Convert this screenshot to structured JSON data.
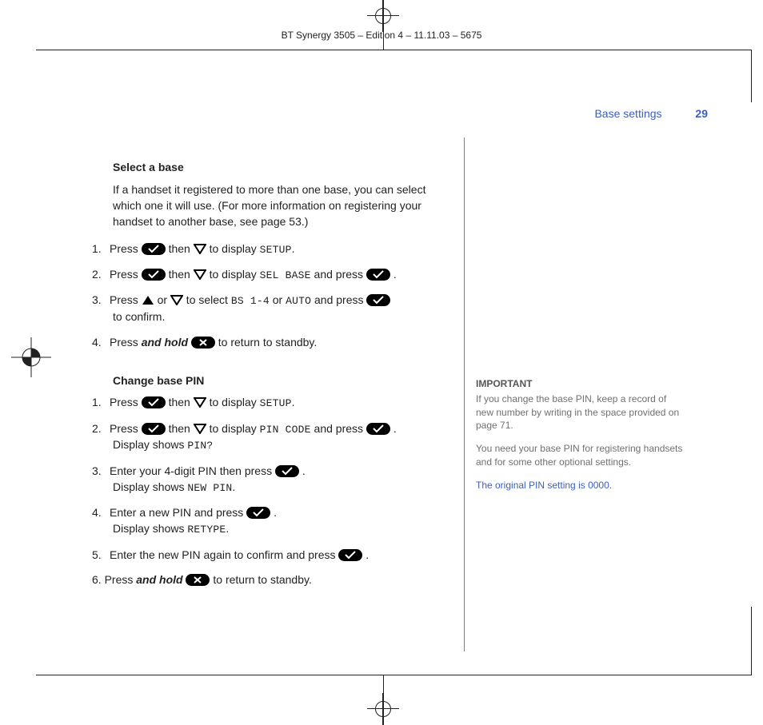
{
  "doc_header": "BT Synergy 3505 – Edition 4 – 11.11.03 – 5675",
  "running_head": {
    "section": "Base settings",
    "page": "29"
  },
  "section1": {
    "title": "Select a base",
    "intro": "If a handset it registered to more than one base, you can select which one it will use. (For more information on registering your handset to another base, see page 53.)",
    "steps": {
      "s1a": "1.",
      "s1b": "Press ",
      "s1c": " then ",
      "s1d": " to display ",
      "s1e": "SETUP",
      "s1f": ".",
      "s2a": "2.",
      "s2b": "Press ",
      "s2c": " then ",
      "s2d": " to display ",
      "s2e": "SEL BASE",
      "s2f": " and press ",
      "s2g": " .",
      "s3a": "3.",
      "s3b": "Press ",
      "s3c": " or ",
      "s3d": " to select ",
      "s3e": "BS 1-4",
      "s3f": " or ",
      "s3g": "AUTO",
      "s3h": " and press ",
      "s3i": " to confirm.",
      "s4a": "4.",
      "s4b": "Press ",
      "s4c": "and hold",
      "s4d": " ",
      "s4e": " to return to standby."
    }
  },
  "section2": {
    "title": "Change base PIN",
    "steps": {
      "s1a": "1.",
      "s1b": "Press ",
      "s1c": " then ",
      "s1d": " to display ",
      "s1e": "SETUP",
      "s1f": ".",
      "s2a": "2.",
      "s2b": "Press ",
      "s2c": " then ",
      "s2d": " to display ",
      "s2e": "PIN CODE",
      "s2f": " and press ",
      "s2g": " .",
      "s2h": "Display shows ",
      "s2i": "PIN?",
      "s3a": "3.",
      "s3b": "Enter your 4-digit PIN then press ",
      "s3c": " .",
      "s3d": "Display shows ",
      "s3e": "NEW PIN",
      "s3f": ".",
      "s4a": "4.",
      "s4b": "Enter a new PIN and press ",
      "s4c": " .",
      "s4d": "Display shows ",
      "s4e": "RETYPE",
      "s4f": ".",
      "s5a": "5.",
      "s5b": "Enter the new PIN again to confirm and press ",
      "s5c": " .",
      "s6a": "6.",
      "s6b": "Press ",
      "s6c": "and hold",
      "s6d": " ",
      "s6e": " to return to standby."
    }
  },
  "sidebar": {
    "head": "IMPORTANT",
    "p1": "If you change the base PIN, keep a record of new number by writing in the space provided on page 71.",
    "p2": "You need your base PIN for registering handsets and for some other optional settings.",
    "p3": "The original PIN setting is 0000."
  }
}
